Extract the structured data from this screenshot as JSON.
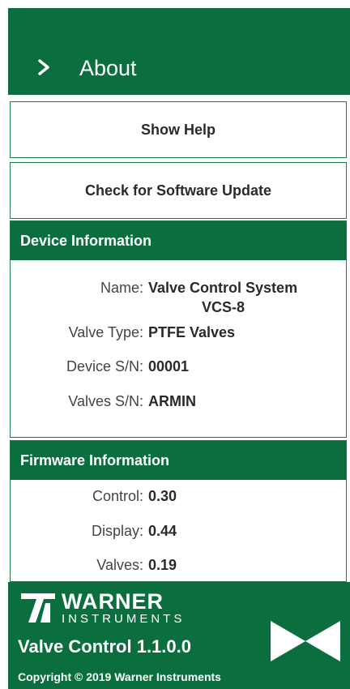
{
  "header": {
    "title": "About"
  },
  "buttons": {
    "show_help": "Show Help",
    "check_update": "Check for Software Update"
  },
  "device": {
    "heading": "Device Information",
    "name_label": "Name:",
    "name_line1": "Valve Control System",
    "name_line2": "VCS-8",
    "valve_type_label": "Valve Type:",
    "valve_type": "PTFE Valves",
    "device_sn_label": "Device S/N:",
    "device_sn": "00001",
    "valves_sn_label": "Valves S/N:",
    "valves_sn": "ARMIN"
  },
  "firmware": {
    "heading": "Firmware Information",
    "control_label": "Control:",
    "control": "0.30",
    "display_label": "Display:",
    "display": "0.44",
    "valves_label": "Valves:",
    "valves": "0.19"
  },
  "footer": {
    "brand": "WARNER",
    "brand_sub": "INSTRUMENTS",
    "version": "Valve Control 1.1.0.0",
    "copyright": "Copyright © 2019 Warner Instruments"
  },
  "colors": {
    "brand_green": "#0b6e3f",
    "border_green": "#1f7a4b"
  },
  "icons": {
    "back": "chevron-right-icon",
    "logo": "warner-logo",
    "valve": "valve-icon"
  }
}
